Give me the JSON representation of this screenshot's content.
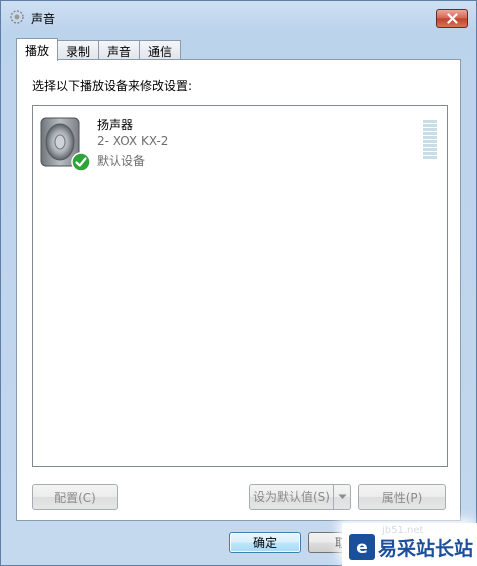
{
  "window": {
    "title": "声音",
    "close_icon": "close-icon"
  },
  "tabs": [
    {
      "label": "播放",
      "active": true
    },
    {
      "label": "录制",
      "active": false
    },
    {
      "label": "声音",
      "active": false
    },
    {
      "label": "通信",
      "active": false
    }
  ],
  "panel": {
    "instruction": "选择以下播放设备来修改设置:",
    "devices": [
      {
        "name": "扬声器",
        "description": "2- XOX KX-2",
        "status": "默认设备",
        "icon": "speaker-icon",
        "badge": "check-icon"
      }
    ]
  },
  "buttons": {
    "configure": "配置(C)",
    "set_default": "设为默认值(S)",
    "properties": "属性(P)",
    "ok": "确定",
    "cancel": "取"
  },
  "watermark": {
    "text": "易采站长站",
    "small": "jb51.net"
  },
  "colors": {
    "accent": "#3c7fb1",
    "check": "#2fa33a",
    "watermark": "#1a4f9c"
  }
}
